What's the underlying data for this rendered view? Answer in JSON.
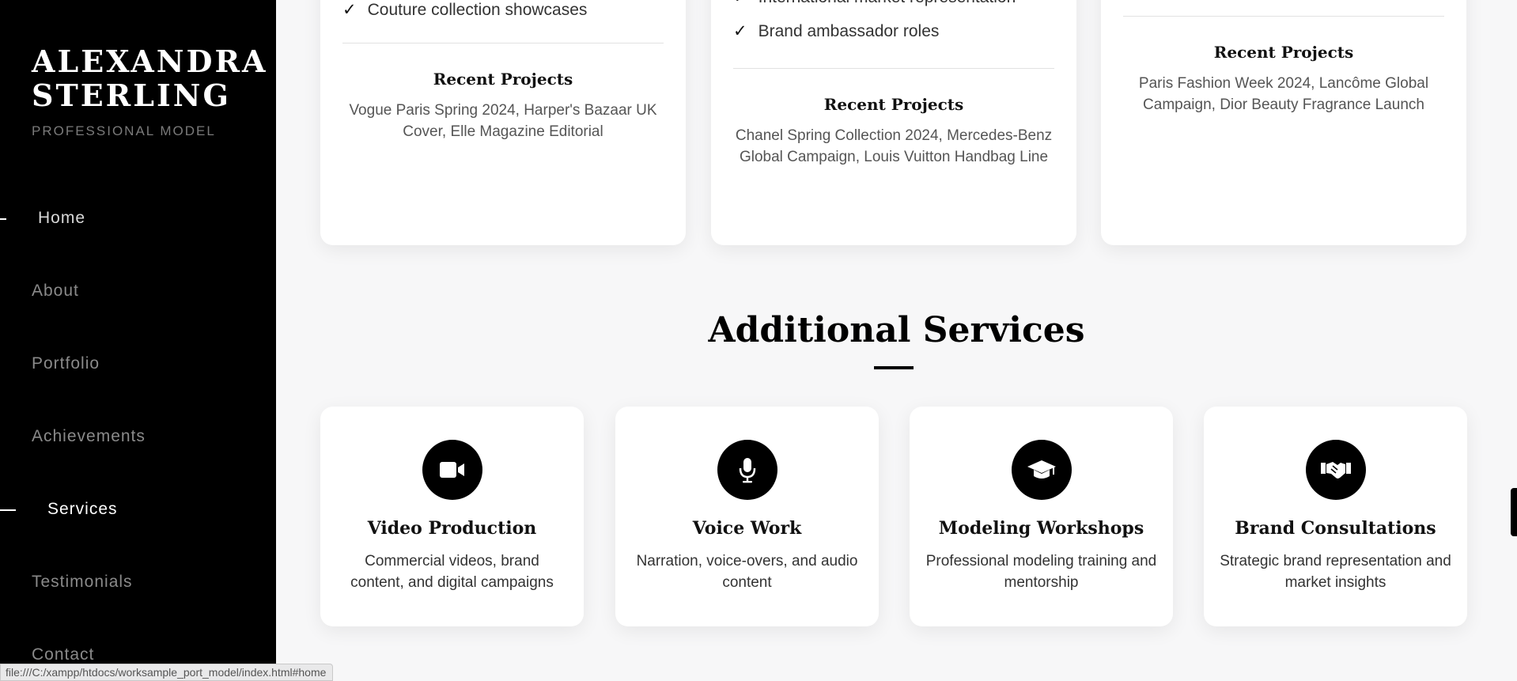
{
  "sidebar": {
    "brand_line1": "ALEXANDRA",
    "brand_line2": "STERLING",
    "subtitle": "PROFESSIONAL MODEL",
    "nav": [
      {
        "label": "Home"
      },
      {
        "label": "About"
      },
      {
        "label": "Portfolio"
      },
      {
        "label": "Achievements"
      },
      {
        "label": "Services"
      },
      {
        "label": "Testimonials"
      },
      {
        "label": "Contact"
      }
    ],
    "active_item": "Services"
  },
  "status_bar": {
    "url": "file:///C:/xampp/htdocs/worksample_port_model/index.html#home"
  },
  "service_cards_top": [
    {
      "feature": "Couture collection showcases",
      "recent_title": "Recent Projects",
      "recent_text": "Vogue Paris Spring 2024, Harper's Bazaar UK Cover, Elle Magazine Editorial"
    },
    {
      "features": [
        "International market representation",
        "Brand ambassador roles"
      ],
      "recent_title": "Recent Projects",
      "recent_text": "Chanel Spring Collection 2024, Mercedes-Benz Global Campaign, Louis Vuitton Handbag Line"
    },
    {
      "recent_title": "Recent Projects",
      "recent_text": "Paris Fashion Week 2024, Lancôme Global Campaign, Dior Beauty Fragrance Launch"
    }
  ],
  "additional_services": {
    "title": "Additional Services",
    "items": [
      {
        "icon": "video-camera-icon",
        "title": "Video Production",
        "desc": "Commercial videos, brand content, and digital campaigns"
      },
      {
        "icon": "microphone-icon",
        "title": "Voice Work",
        "desc": "Narration, voice-overs, and audio content"
      },
      {
        "icon": "graduation-cap-icon",
        "title": "Modeling Workshops",
        "desc": "Professional modeling training and mentorship"
      },
      {
        "icon": "handshake-icon",
        "title": "Brand Consultations",
        "desc": "Strategic brand representation and market insights"
      }
    ]
  },
  "check_glyph": "✓",
  "colors": {
    "sidebar_bg": "#000000",
    "page_bg": "#f7f7f8",
    "card_bg": "#ffffff",
    "accent": "#000000"
  }
}
